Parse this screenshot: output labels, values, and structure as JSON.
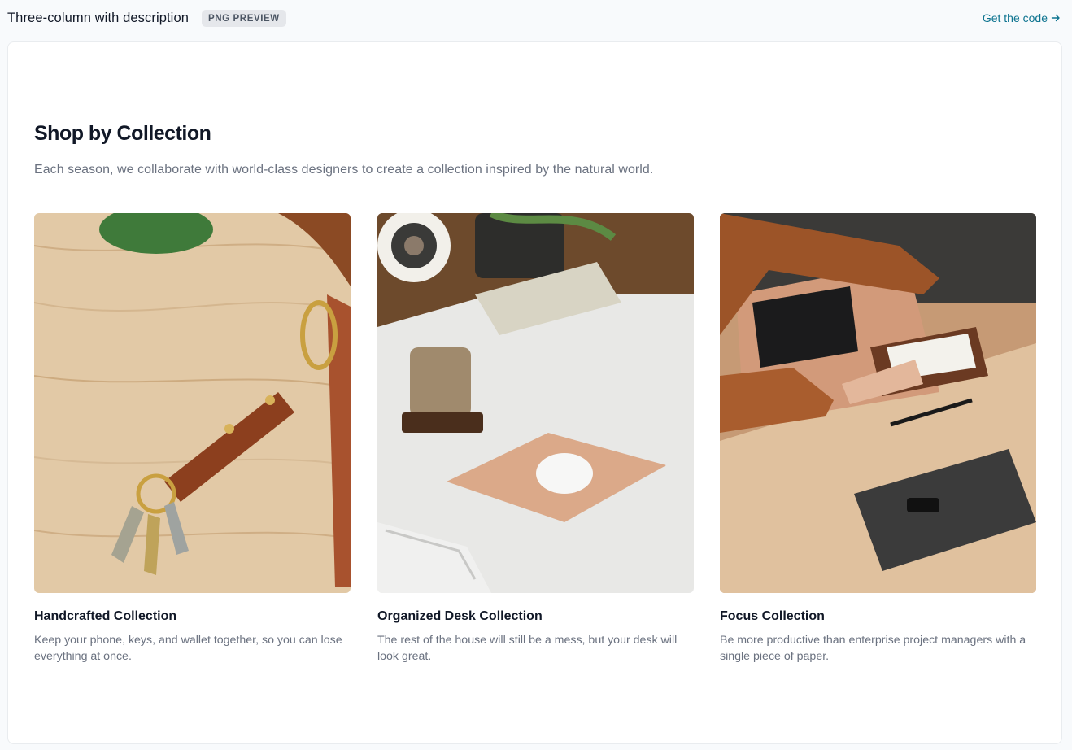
{
  "header": {
    "title": "Three-column with description",
    "badge": "PNG PREVIEW",
    "get_code_label": "Get the code"
  },
  "section": {
    "title": "Shop by Collection",
    "description": "Each season, we collaborate with world-class designers to create a collection inspired by the natural world."
  },
  "collections": [
    {
      "name": "Handcrafted Collection",
      "description": "Keep your phone, keys, and wallet together, so you can lose everything at once.",
      "image": "leather-keychain-on-wood-photo"
    },
    {
      "name": "Organized Desk Collection",
      "description": "The rest of the house will still be a mess, but your desk will look great.",
      "image": "desk-mousepad-mug-speaker-photo"
    },
    {
      "name": "Focus Collection",
      "description": "Be more productive than enterprise project managers with a single piece of paper.",
      "image": "desk-tablet-notepad-felt-case-photo"
    }
  ],
  "colors": {
    "accent": "#0e7490",
    "heading": "#111827",
    "muted": "#6b7280"
  }
}
